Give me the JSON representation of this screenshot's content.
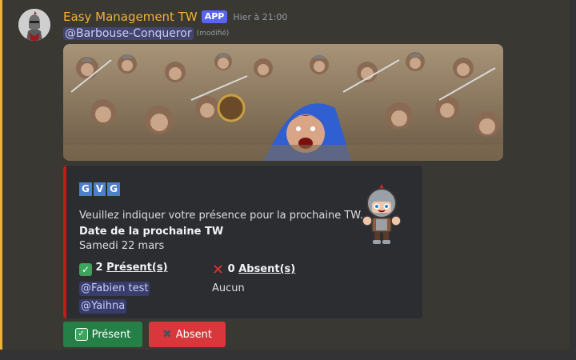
{
  "message": {
    "username": "Easy Management TW",
    "app_tag": "APP",
    "timestamp": "Hier à 21:00",
    "mention": "@Barbouse-Conqueror",
    "edited": "(modifié)"
  },
  "embed": {
    "title_letters": [
      "G",
      "V",
      "G"
    ],
    "description": "Veuillez indiquer votre présence pour la prochaine TW.",
    "date_field": {
      "name": "Date de la prochaine TW",
      "value": "Samedi 22 mars"
    },
    "present_field": {
      "count": "2",
      "label": "Présent(s)",
      "members": [
        "@Fabien test",
        "@Yaihna"
      ]
    },
    "absent_field": {
      "count": "0",
      "label": "Absent(s)",
      "value": "Aucun"
    },
    "accent_color": "#c41a1a"
  },
  "buttons": {
    "present": {
      "label": "Présent",
      "icon": "check-mark-icon",
      "color": "#248046"
    },
    "absent": {
      "label": "Absent",
      "icon": "cross-mark-icon",
      "color": "#da373c"
    }
  },
  "colors": {
    "username": "#f0b232",
    "app_tag": "#5865f2",
    "mention_bg": "rgba(88,101,242,0.3)"
  }
}
